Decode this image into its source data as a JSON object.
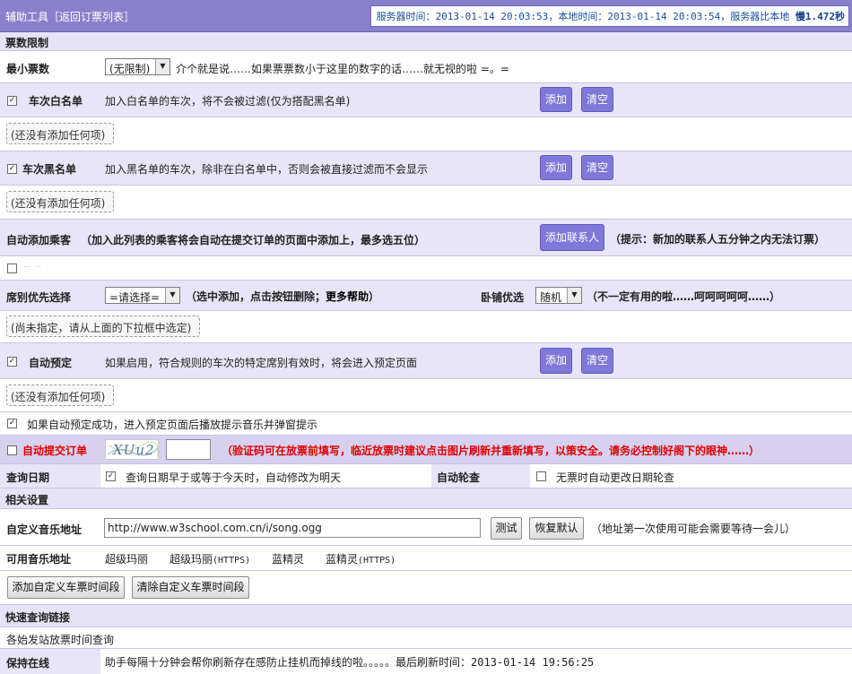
{
  "header": {
    "title": "辅助工具［返回订票列表］",
    "server_time_label": "服务器时间：",
    "server_time": "2013-01-14 20:03:53",
    "local_time_label": "，本地时间：",
    "local_time": "2013-01-14 20:03:54",
    "compare_label": "，服务器比本地",
    "compare_value": "慢1.472秒"
  },
  "sections": {
    "ticket_limit": "票数限制",
    "related": "相关设置",
    "quick_links": "快速查询链接"
  },
  "min_tickets": {
    "label": "最小票数",
    "select_value": "(无限制)",
    "desc": "介个就是说……如果票票数小于这里的数字的话……就无视的啦 =。="
  },
  "whitelist": {
    "label": "车次白名单",
    "checked": true,
    "desc": "加入白名单的车次，将不会被过滤(仅为搭配黑名单)",
    "add": "添加",
    "clear": "清空",
    "empty": "(还没有添加任何项)"
  },
  "blacklist": {
    "label": "车次黑名单",
    "checked": true,
    "desc": "加入黑名单的车次，除非在白名单中，否则会被直接过滤而不会显示",
    "add": "添加",
    "clear": "清空",
    "empty": "(还没有添加任何项)"
  },
  "auto_passenger": {
    "label": "自动添加乘客",
    "desc": "（加入此列表的乘客将会自动在提交订单的页面中添加上，最多选五位）",
    "add_contact": "添加联系人",
    "tip": "（提示：新加的联系人五分钟之内无法订票）",
    "passenger_name": "... ..."
  },
  "seat_priority": {
    "label": "席别优先选择",
    "select_value": "=请选择=",
    "desc": "（选中添加，点击按钮删除；",
    "help": "更多帮助",
    "desc_end": "）",
    "berth_label": "卧铺优选",
    "berth_value": "随机",
    "berth_desc": "（不一定有用的啦……呵呵呵呵呵……）",
    "empty": "(尚未指定，请从上面的下拉框中选定)"
  },
  "auto_reserve": {
    "label": "自动预定",
    "checked": true,
    "desc": "如果启用，符合规则的车次的特定席别有效时，将会进入预定页面",
    "add": "添加",
    "clear": "清空",
    "empty": "(还没有添加任何项)",
    "music_option": "如果自动预定成功，进入预定页面后播放提示音乐并弹窗提示",
    "music_checked": true
  },
  "auto_submit": {
    "label": "自动提交订单",
    "checked": false,
    "captcha_text": "XUu2",
    "warning": "（验证码可在放票前填写，临近放票时建议点击图片刷新并重新填写，以策安全。请务必控制好阁下的眼神……）"
  },
  "query_date": {
    "label": "查询日期",
    "checked": true,
    "desc": "查询日期早于或等于今天时，自动修改为明天",
    "poll_label": "自动轮查",
    "poll_checked": false,
    "poll_desc": "无票时自动更改日期轮查"
  },
  "music": {
    "label": "自定义音乐地址",
    "url": "http://www.w3school.com.cn/i/song.ogg",
    "test": "测试",
    "restore": "恢复默认",
    "hint": "（地址第一次使用可能会需要等待一会儿）",
    "available_label": "可用音乐地址",
    "options": [
      {
        "name": "超级玛丽",
        "suffix": ""
      },
      {
        "name": "超级玛丽",
        "suffix": "(HTTPS)"
      },
      {
        "name": "蓝精灵",
        "suffix": ""
      },
      {
        "name": "蓝精灵",
        "suffix": "(HTTPS)"
      }
    ]
  },
  "time_buttons": {
    "add": "添加自定义车票时间段",
    "clear": "清除自定义车票时间段"
  },
  "quick": {
    "link": "各始发站放票时间查询"
  },
  "online": {
    "label": "保持在线",
    "desc": "助手每隔十分钟会帮你刷新存在感防止挂机而掉线的啦。。。。。最后刷新时间：",
    "time": "2013-01-14 19:56:25"
  }
}
